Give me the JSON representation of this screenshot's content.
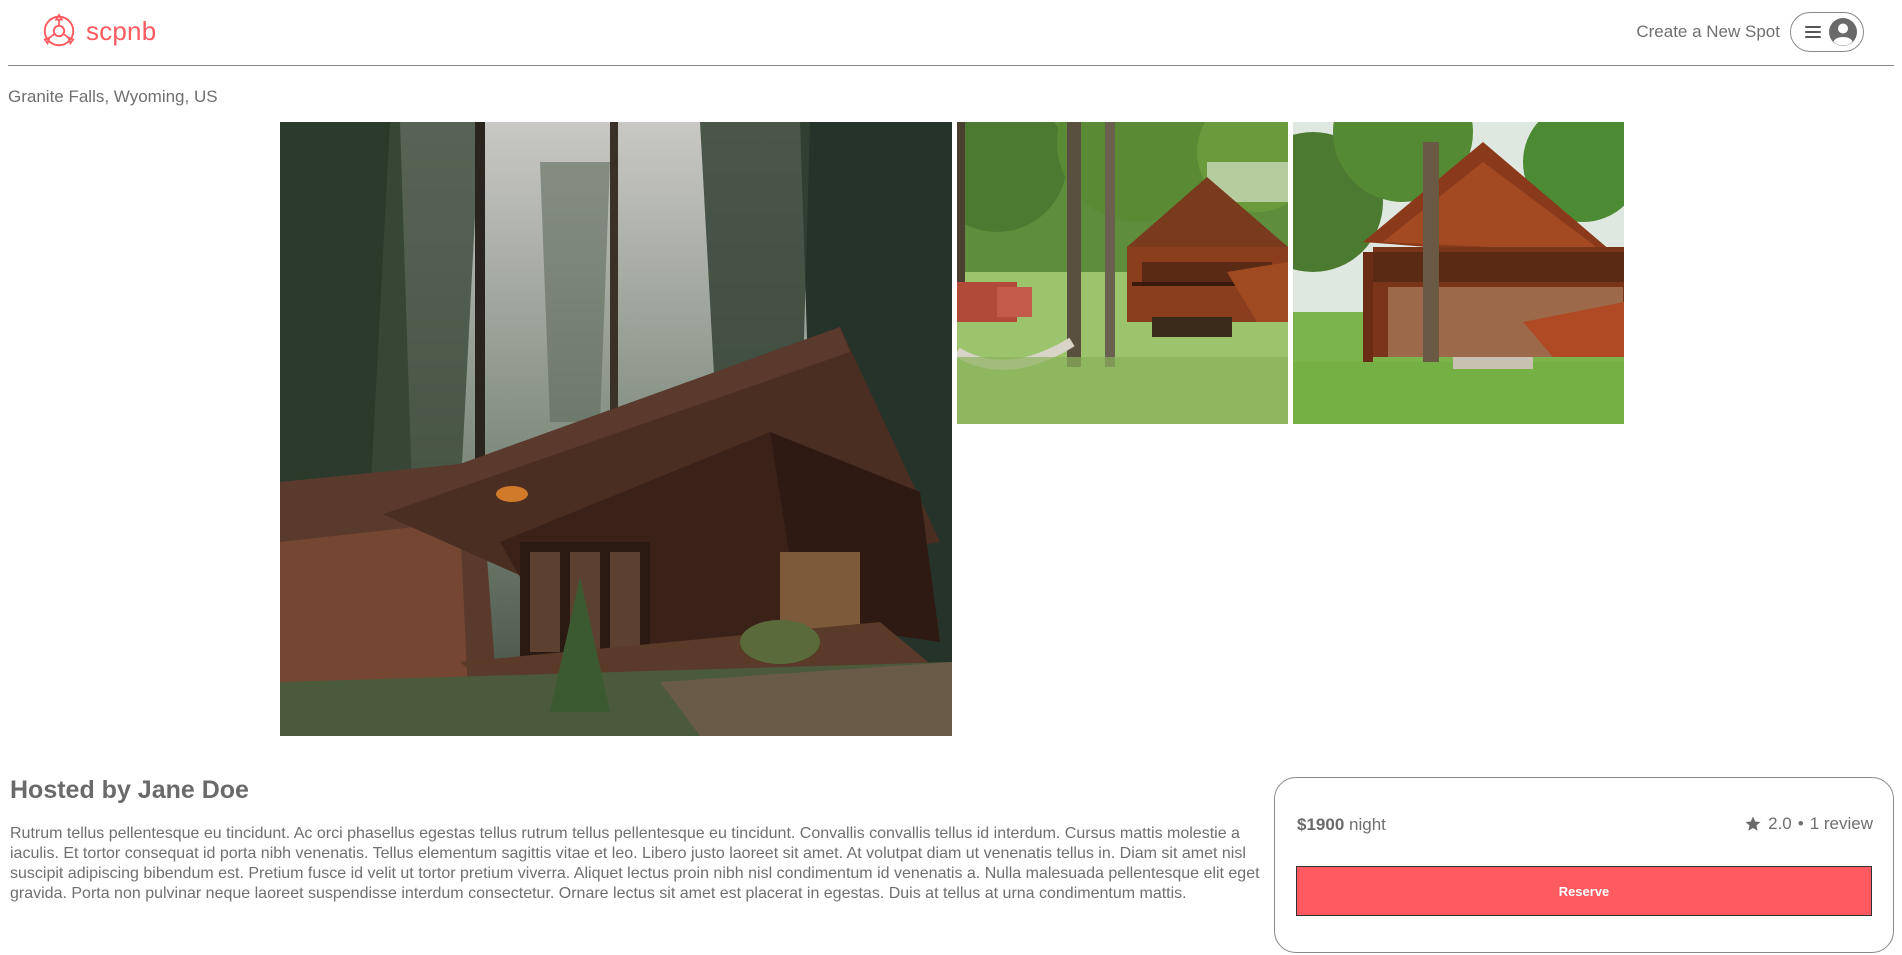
{
  "header": {
    "logo_text": "scpnb",
    "create_link": "Create a New Spot",
    "menu_icon": "hamburger-icon",
    "avatar_icon": "user-circle-icon"
  },
  "spot": {
    "location": "Granite Falls, Wyoming, US",
    "images": [
      {
        "name": "dark A-frame cabin in misty forest"
      },
      {
        "name": "log cabin with hammock under oak trees"
      },
      {
        "name": "log cabin with deck on green lawn"
      }
    ]
  },
  "host": {
    "title": "Hosted by Jane Doe",
    "description": "Rutrum tellus pellentesque eu tincidunt. Ac orci phasellus egestas tellus rutrum tellus pellentesque eu tincidunt. Convallis convallis tellus id interdum. Cursus mattis molestie a iaculis. Et tortor consequat id porta nibh venenatis. Tellus elementum sagittis vitae et leo. Libero justo laoreet sit amet. At volutpat diam ut venenatis tellus in. Diam sit amet nisl suscipit adipiscing bibendum est. Pretium fusce id velit ut tortor pretium viverra. Aliquet lectus proin nibh nisl condimentum id venenatis a. Nulla malesuada pellentesque elit eget gravida. Porta non pulvinar neque laoreet suspendisse interdum consectetur. Ornare lectus sit amet est placerat in egestas. Duis at tellus at urna condimentum mattis."
  },
  "booking": {
    "price": "$1900",
    "price_unit": "night",
    "rating": "2.0",
    "separator": "•",
    "reviews": "1 review",
    "reserve_label": "Reserve"
  },
  "colors": {
    "brand": "#ff5a5f",
    "text": "#717171",
    "border": "#8a8a8a"
  }
}
